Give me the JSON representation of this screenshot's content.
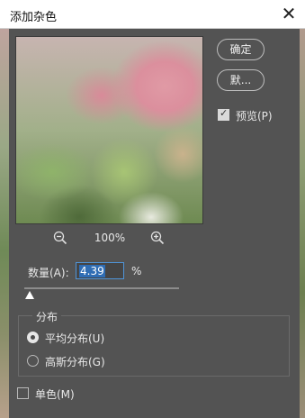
{
  "dialog": {
    "title": "添加杂色"
  },
  "preview": {
    "zoom_level": "100%"
  },
  "buttons": {
    "ok_label": "确定",
    "default_label": "默..."
  },
  "preview_toggle": {
    "label": "预览(P)",
    "checked": true
  },
  "amount": {
    "label": "数量(A):",
    "value": "4.39",
    "unit": "%"
  },
  "distribution": {
    "legend": "分布",
    "options": [
      {
        "label": "平均分布(U)",
        "selected": true
      },
      {
        "label": "高斯分布(G)",
        "selected": false
      }
    ]
  },
  "monochromatic": {
    "label": "单色(M)",
    "checked": false
  },
  "icons": [
    "close-icon",
    "zoom-out-icon",
    "zoom-in-icon"
  ]
}
